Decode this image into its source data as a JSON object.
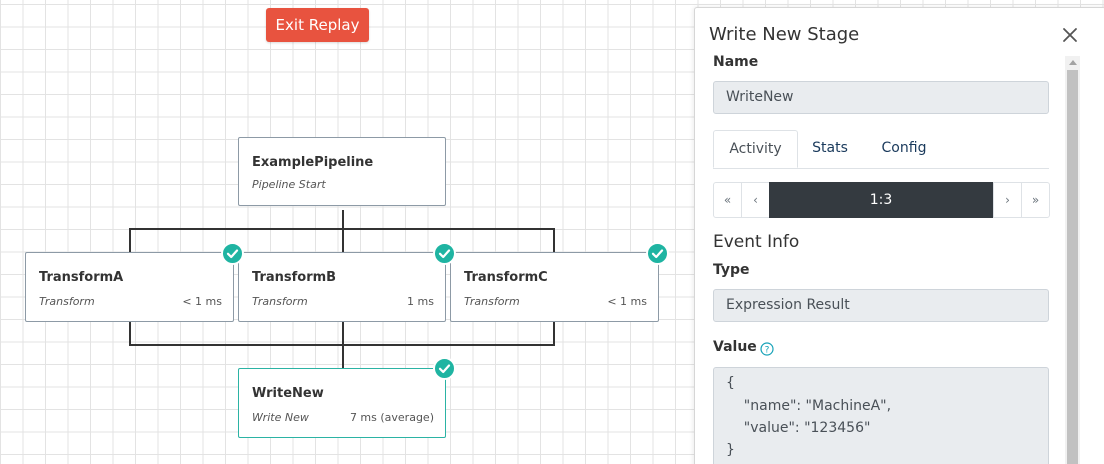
{
  "toolbar": {
    "exit_replay_label": "Exit Replay"
  },
  "pipeline": {
    "start": {
      "name": "ExamplePipeline",
      "type": "Pipeline Start"
    },
    "transforms": [
      {
        "name": "TransformA",
        "type": "Transform",
        "time": "< 1 ms",
        "status": "success"
      },
      {
        "name": "TransformB",
        "type": "Transform",
        "time": "1 ms",
        "status": "success"
      },
      {
        "name": "TransformC",
        "type": "Transform",
        "time": "< 1 ms",
        "status": "success"
      }
    ],
    "writer": {
      "name": "WriteNew",
      "type": "Write New",
      "time": "7 ms (average)",
      "status": "success"
    }
  },
  "panel": {
    "title": "Write New Stage",
    "name_label": "Name",
    "name_value": "WriteNew",
    "tabs": [
      "Activity",
      "Stats",
      "Config"
    ],
    "active_tab": "Activity",
    "pager": {
      "first": "«",
      "prev": "‹",
      "current": "1:3",
      "next": "›",
      "last": "»"
    },
    "event_info_title": "Event Info",
    "type_label": "Type",
    "type_value": "Expression Result",
    "value_label": "Value",
    "value_lines": [
      "{",
      "    \"name\": \"MachineA\",",
      "    \"value\": \"123456\"",
      "}"
    ]
  },
  "colors": {
    "exit_button": "#e8533f",
    "success_check": "#1fb4a2",
    "pager_current": "#343a40"
  }
}
